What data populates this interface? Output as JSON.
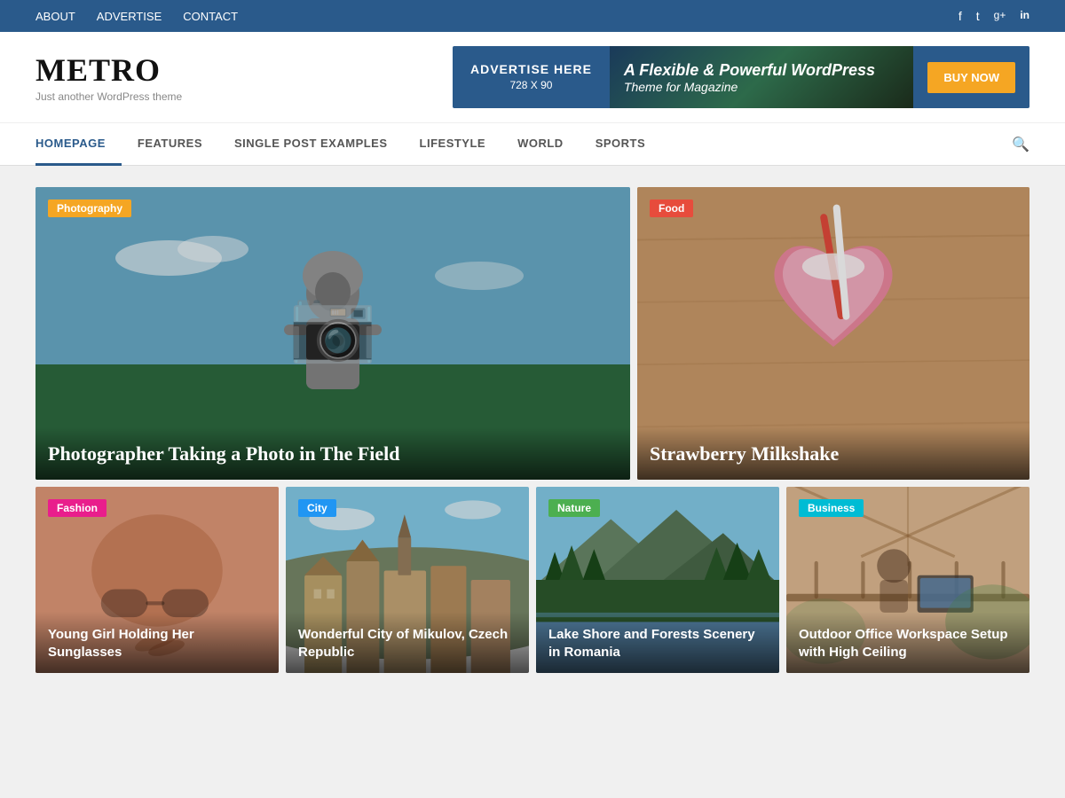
{
  "topbar": {
    "nav": [
      {
        "label": "ABOUT",
        "href": "#"
      },
      {
        "label": "ADVERTISE",
        "href": "#"
      },
      {
        "label": "CONTACT",
        "href": "#"
      }
    ],
    "social": [
      {
        "name": "facebook",
        "icon": "f"
      },
      {
        "name": "twitter",
        "icon": "t"
      },
      {
        "name": "googleplus",
        "icon": "g+"
      },
      {
        "name": "linkedin",
        "icon": "in"
      }
    ]
  },
  "header": {
    "logo": "METRO",
    "tagline": "Just another WordPress theme",
    "ad": {
      "left_line1": "ADVERTISE HERE",
      "left_line2": "728 X 90",
      "middle_line1": "A Flexible & Powerful WordPress",
      "middle_line2": "Theme for Magazine",
      "button": "BUY NOW"
    }
  },
  "nav": {
    "items": [
      {
        "label": "HOMEPAGE",
        "active": true
      },
      {
        "label": "FEATURES",
        "active": false
      },
      {
        "label": "SINGLE POST EXAMPLES",
        "active": false
      },
      {
        "label": "LIFESTYLE",
        "active": false
      },
      {
        "label": "WORLD",
        "active": false
      },
      {
        "label": "SPORTS",
        "active": false
      }
    ]
  },
  "featured": [
    {
      "id": "featured-large",
      "category": "Photography",
      "category_color": "#f5a623",
      "title": "Photographer Taking a Photo in The Field",
      "bg_class": "bg-photographer"
    },
    {
      "id": "featured-small",
      "category": "Food",
      "category_color": "#e74c3c",
      "title": "Strawberry Milkshake",
      "bg_class": "bg-milkshake"
    }
  ],
  "bottom_cards": [
    {
      "id": "card-fashion",
      "category": "Fashion",
      "category_color": "#e91e8c",
      "title": "Young Girl Holding Her Sunglasses",
      "bg_class": "bg-fashion"
    },
    {
      "id": "card-city",
      "category": "City",
      "category_color": "#2196f3",
      "title": "Wonderful City of Mikulov, Czech Republic",
      "bg_class": "bg-city"
    },
    {
      "id": "card-nature",
      "category": "Nature",
      "category_color": "#4caf50",
      "title": "Lake Shore and Forests Scenery in Romania",
      "bg_class": "bg-nature"
    },
    {
      "id": "card-business",
      "category": "Business",
      "category_color": "#00bcd4",
      "title": "Outdoor Office Workspace Setup with High Ceiling",
      "bg_class": "bg-business"
    }
  ]
}
